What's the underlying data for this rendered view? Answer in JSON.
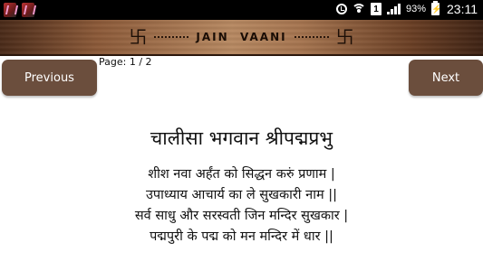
{
  "status_bar": {
    "time": "23:11",
    "battery_percent": "93%",
    "sim_label": "1",
    "icons": [
      "app-icon",
      "app-icon",
      "alarm-icon",
      "wifi-icon",
      "sim-icon",
      "signal-icon",
      "battery-charging-icon"
    ]
  },
  "header": {
    "title": "JAIN  VAANI",
    "emblem_left": "卐",
    "emblem_right": "卐"
  },
  "nav": {
    "previous_label": "Previous",
    "next_label": "Next",
    "page_indicator": "Page: 1 / 2"
  },
  "content": {
    "title": "चालीसा भगवान श्रीपद्मप्रभु",
    "lines": [
      "शीश नवा अर्हंत को सिद्धन करुं प्रणाम |",
      "उपाध्याय आचार्य का ले सुखकारी नाम ||",
      "सर्व साधु और सरस्वती जिन मन्दिर सुखकार |",
      "पद्मपुरी के पद्म को मन मन्दिर में धार ||"
    ]
  },
  "colors": {
    "button_bg": "#6b4e3d",
    "status_bar_bg": "#000000",
    "banner_wood": "#a87650"
  }
}
